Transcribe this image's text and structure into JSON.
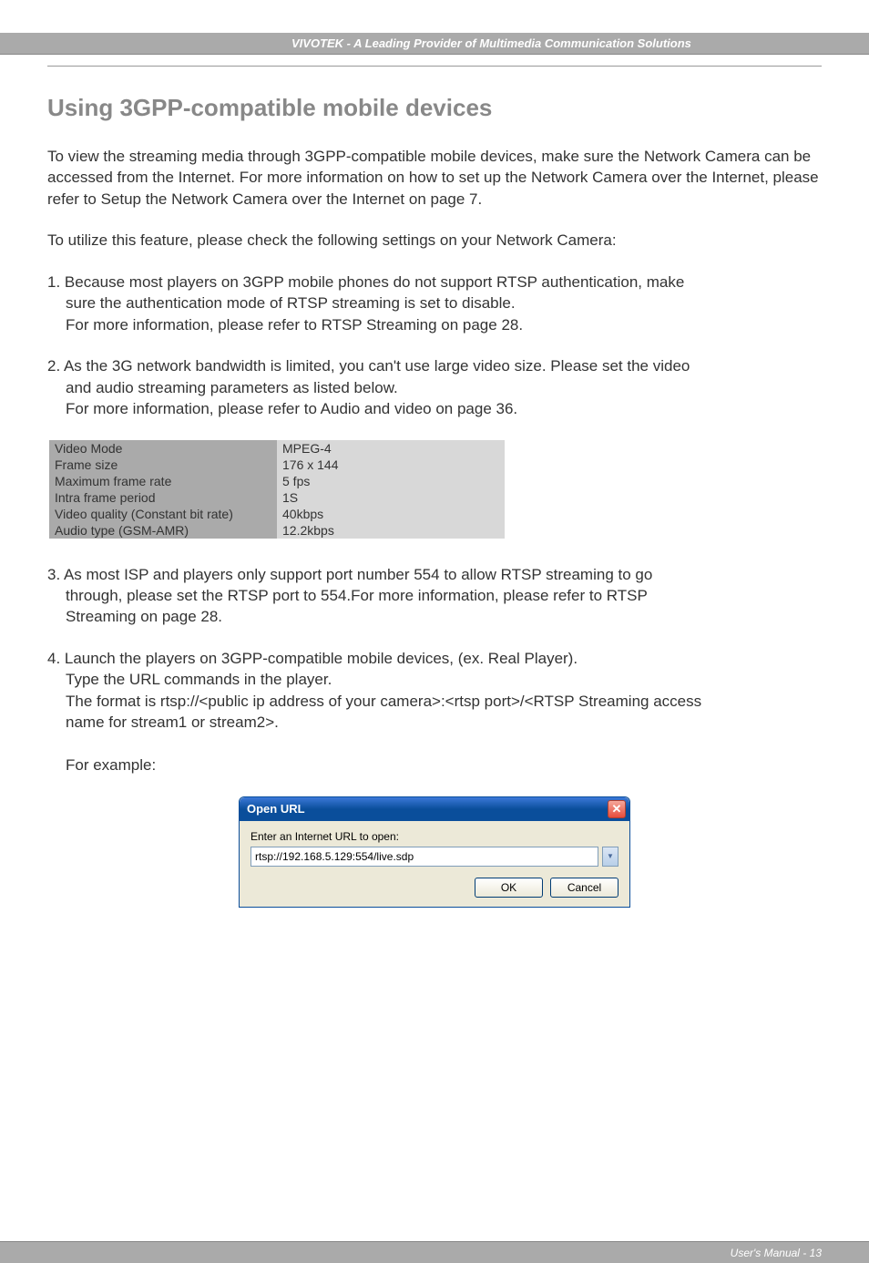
{
  "header": {
    "text": "VIVOTEK - A Leading Provider of Multimedia Communication Solutions"
  },
  "title": "Using 3GPP-compatible mobile devices",
  "para1": "To view the streaming media through 3GPP-compatible mobile devices, make sure the Network Camera can be accessed from the Internet. For more information on how to set up the Network Camera over the Internet, please refer to Setup the Network Camera over the Internet on page 7.",
  "para2": "To utilize this feature, please check the following settings on your Network Camera:",
  "item1_line1": "1. Because most players on 3GPP mobile phones do not support RTSP authentication, make",
  "item1_line2": "sure the authentication mode of RTSP streaming is set to disable.",
  "item1_line3": "For more information, please refer to RTSP Streaming on page 28.",
  "item2_line1": "2. As the 3G network bandwidth is limited, you can't use large video size. Please set the video",
  "item2_line2": "and audio streaming parameters as listed below.",
  "item2_line3": "For more information, please refer to Audio and video on page 36.",
  "table": {
    "rows": [
      {
        "label": "Video Mode",
        "value": "MPEG-4"
      },
      {
        "label": "Frame size",
        "value": "176 x 144"
      },
      {
        "label": "Maximum frame rate",
        "value": "5 fps"
      },
      {
        "label": "Intra frame period",
        "value": "1S"
      },
      {
        "label": "Video quality (Constant bit rate)",
        "value": "40kbps"
      },
      {
        "label": "Audio type (GSM-AMR)",
        "value": "12.2kbps"
      }
    ]
  },
  "item3_line1": "3. As most ISP and players only support port number 554 to allow RTSP streaming to go",
  "item3_line2": "through, please set the RTSP port to 554.For more information, please refer to RTSP",
  "item3_line3": "Streaming on page 28.",
  "item4_line1": "4. Launch the players on 3GPP-compatible mobile devices, (ex. Real Player).",
  "item4_line2": "Type the URL commands in the player.",
  "item4_line3": "The format is rtsp://<public ip address of your camera>:<rtsp port>/<RTSP Streaming access",
  "item4_line4": "name for stream1 or stream2>.",
  "item4_line5": "For example:",
  "dialog": {
    "title": "Open URL",
    "label": "Enter an Internet URL to open:",
    "url": "rtsp://192.168.5.129:554/live.sdp",
    "ok": "OK",
    "cancel": "Cancel"
  },
  "footer": {
    "text": "User's Manual - 13"
  }
}
